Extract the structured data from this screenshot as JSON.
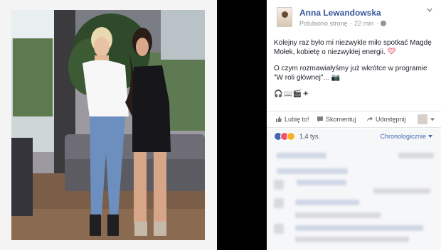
{
  "post": {
    "author": "Anna Lewandowska",
    "liked_page": "Polubiono stronę",
    "time": "22 min",
    "paragraph1": "Kolejny raz było mi niezwykle miło spotkać Magdę Mołek, kobietę o niezwykłej energii.",
    "paragraph2": "O czym rozmawiałyśmy już wkrótce w programie \"W roli głównej\"...",
    "paragraph2_icon": "camera-emoji-icon",
    "emoji_line": "🎧📖🎬☀"
  },
  "actions": {
    "like": "Lubię to!",
    "comment": "Skomentuj",
    "share": "Udostępnij"
  },
  "reactions": {
    "count": "1,4 tys.",
    "order": "Chronologicznie"
  },
  "colors": {
    "link": "#365899",
    "accent": "#4267b2",
    "heart": "#f25268",
    "wow": "#f7b125"
  }
}
